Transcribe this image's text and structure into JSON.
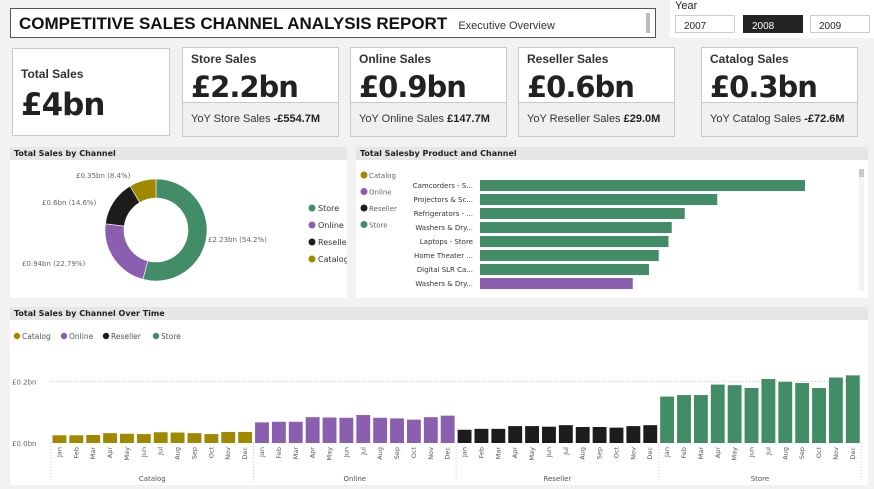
{
  "header": {
    "title": "COMPETITIVE SALES CHANNEL ANALYSIS REPORT",
    "subtitle": "Executive Overview"
  },
  "year_slicer": {
    "label": "Year",
    "options": [
      "2007",
      "2008",
      "2009"
    ],
    "selected": "2008"
  },
  "kpis": {
    "total": {
      "label": "Total Sales",
      "value": "£4bn"
    },
    "cards": [
      {
        "label": "Store Sales",
        "value": "£2.2bn",
        "yoy_label": "YoY Store Sales",
        "yoy_value": "-£554.7M"
      },
      {
        "label": "Online Sales",
        "value": "£0.9bn",
        "yoy_label": "YoY Online Sales",
        "yoy_value": "£147.7M"
      },
      {
        "label": "Reseller Sales",
        "value": "£0.6bn",
        "yoy_label": "YoY Reseller Sales",
        "yoy_value": "£29.0M"
      },
      {
        "label": "Catalog Sales",
        "value": "£0.3bn",
        "yoy_label": "YoY Catalog Sales",
        "yoy_value": "-£72.6M"
      }
    ]
  },
  "colors": {
    "Store": "#438c68",
    "Online": "#8a5fb0",
    "Reseller": "#1c1c1c",
    "Catalog": "#a08900"
  },
  "chart_data": [
    {
      "type": "pie",
      "title": "Total Sales by Channel",
      "donut": true,
      "legend": "right",
      "legend_entries": [
        "Store",
        "Online",
        "Reseller",
        "Catalog"
      ],
      "slices": [
        {
          "name": "Store",
          "value": 2.23,
          "label": "£2.23bn (54.2%)"
        },
        {
          "name": "Online",
          "value": 0.94,
          "label": "£0.94bn (22.79%)"
        },
        {
          "name": "Reseller",
          "value": 0.6,
          "label": "£0.6bn (14.6%)"
        },
        {
          "name": "Catalog",
          "value": 0.35,
          "label": "£0.35bn (8.4%)"
        }
      ]
    },
    {
      "type": "bar",
      "orientation": "horizontal",
      "title": "Total Salesby Product and Channel",
      "legend": "left",
      "legend_entries": [
        "Catalog",
        "Online",
        "Reseller",
        "Store"
      ],
      "categories": [
        "Camcorders - S...",
        "Projectors & Sc...",
        "Refrigerators - ...",
        "Washers & Dry...",
        "Laptops - Store",
        "Home Theater ...",
        "Digital SLR Ca...",
        "Washers & Dry..."
      ],
      "channels": [
        "Store",
        "Store",
        "Store",
        "Store",
        "Store",
        "Store",
        "Store",
        "Online"
      ],
      "values_relative": [
        1.0,
        0.73,
        0.63,
        0.59,
        0.58,
        0.55,
        0.52,
        0.47
      ]
    },
    {
      "type": "bar",
      "title": "Total Sales by Channel Over Time",
      "legend": "top-left",
      "grid": true,
      "legend_entries": [
        "Catalog",
        "Online",
        "Reseller",
        "Store"
      ],
      "y_ticks": [
        "£0.0bn",
        "£0.2bn"
      ],
      "ylim": [
        0,
        0.2
      ],
      "months": [
        "Jan",
        "Feb",
        "Mar",
        "Apr",
        "May",
        "Jun",
        "Jul",
        "Aug",
        "Sep",
        "Oct",
        "Nov",
        "Dec"
      ],
      "series": [
        {
          "name": "Catalog",
          "values": [
            0.025,
            0.025,
            0.026,
            0.032,
            0.03,
            0.029,
            0.035,
            0.034,
            0.032,
            0.029,
            0.036,
            0.036
          ]
        },
        {
          "name": "Online",
          "values": [
            0.067,
            0.069,
            0.069,
            0.084,
            0.083,
            0.082,
            0.091,
            0.082,
            0.08,
            0.076,
            0.084,
            0.089
          ]
        },
        {
          "name": "Reseller",
          "values": [
            0.043,
            0.046,
            0.046,
            0.055,
            0.055,
            0.053,
            0.058,
            0.052,
            0.052,
            0.05,
            0.055,
            0.058
          ]
        },
        {
          "name": "Store",
          "values": [
            0.151,
            0.156,
            0.156,
            0.19,
            0.188,
            0.179,
            0.208,
            0.199,
            0.195,
            0.179,
            0.213,
            0.22
          ]
        }
      ]
    }
  ]
}
